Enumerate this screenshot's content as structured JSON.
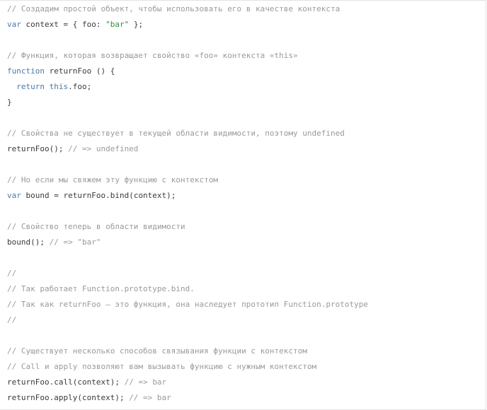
{
  "colors": {
    "comment": "#9a9a9a",
    "keyword": "#4a7aa8",
    "string": "#2f8f3a",
    "plain": "#3a3a3a",
    "border": "#e3e3e3"
  },
  "code": {
    "lines": [
      [
        {
          "t": "comment",
          "v": "// Создадим простой объект, чтобы использовать его в качестве контекста"
        }
      ],
      [
        {
          "t": "keyword",
          "v": "var"
        },
        {
          "t": "plain",
          "v": " context = { foo: "
        },
        {
          "t": "string",
          "v": "\"bar\""
        },
        {
          "t": "plain",
          "v": " };"
        }
      ],
      [],
      [
        {
          "t": "comment",
          "v": "// Функция, которая возвращает свойство «foo» контекста «this»"
        }
      ],
      [
        {
          "t": "keyword",
          "v": "function"
        },
        {
          "t": "plain",
          "v": " returnFoo () {"
        }
      ],
      [
        {
          "t": "plain",
          "v": "  "
        },
        {
          "t": "keyword",
          "v": "return"
        },
        {
          "t": "plain",
          "v": " "
        },
        {
          "t": "keyword",
          "v": "this"
        },
        {
          "t": "plain",
          "v": ".foo;"
        }
      ],
      [
        {
          "t": "plain",
          "v": "}"
        }
      ],
      [],
      [
        {
          "t": "comment",
          "v": "// Свойства не существует в текущей области видимости, поэтому undefined"
        }
      ],
      [
        {
          "t": "plain",
          "v": "returnFoo(); "
        },
        {
          "t": "comment",
          "v": "// => undefined"
        }
      ],
      [],
      [
        {
          "t": "comment",
          "v": "// Но если мы свяжем эту функцию с контекстом"
        }
      ],
      [
        {
          "t": "keyword",
          "v": "var"
        },
        {
          "t": "plain",
          "v": " bound = returnFoo.bind(context);"
        }
      ],
      [],
      [
        {
          "t": "comment",
          "v": "// Свойство теперь в области видимости"
        }
      ],
      [
        {
          "t": "plain",
          "v": "bound(); "
        },
        {
          "t": "comment",
          "v": "// => \"bar\""
        }
      ],
      [],
      [
        {
          "t": "comment",
          "v": "//"
        }
      ],
      [
        {
          "t": "comment",
          "v": "// Так работает Function.prototype.bind."
        }
      ],
      [
        {
          "t": "comment",
          "v": "// Так как returnFoo — это функция, она наследует прототип Function.prototype"
        }
      ],
      [
        {
          "t": "comment",
          "v": "//"
        }
      ],
      [],
      [
        {
          "t": "comment",
          "v": "// Существует несколько способов связывания функции с контекстом"
        }
      ],
      [
        {
          "t": "comment",
          "v": "// Call и apply позволяют вам вызывать функцию с нужным контекстом"
        }
      ],
      [
        {
          "t": "plain",
          "v": "returnFoo.call(context); "
        },
        {
          "t": "comment",
          "v": "// => bar"
        }
      ],
      [
        {
          "t": "plain",
          "v": "returnFoo.apply(context); "
        },
        {
          "t": "comment",
          "v": "// => bar"
        }
      ]
    ]
  }
}
